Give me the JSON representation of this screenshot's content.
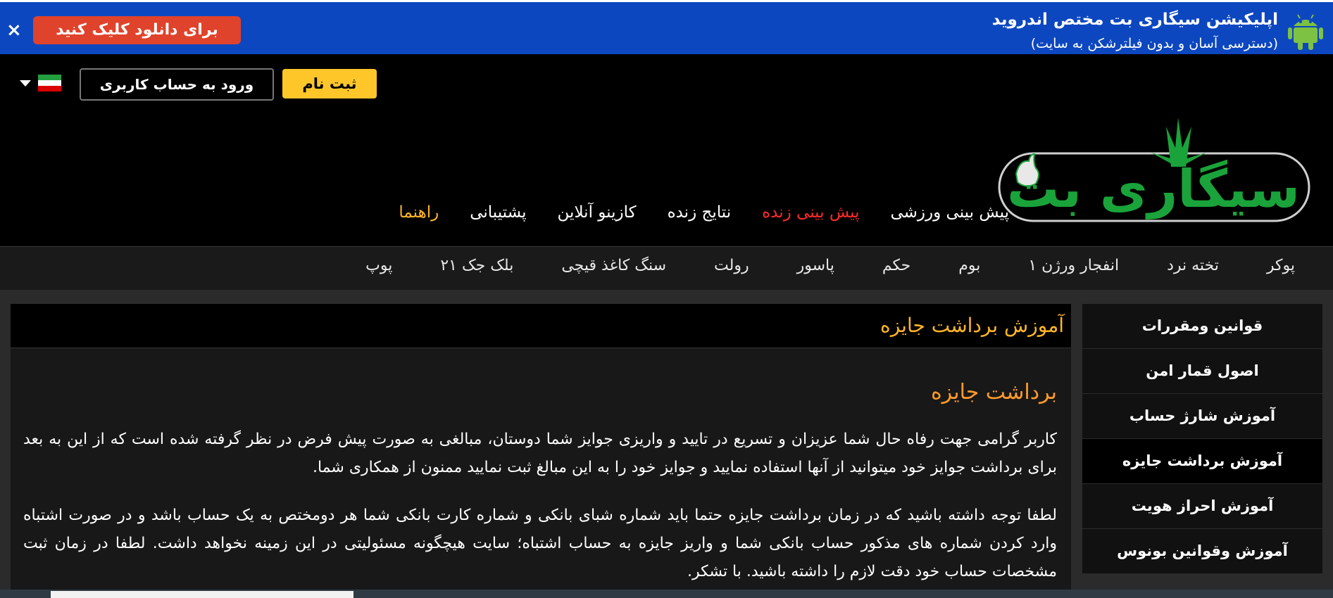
{
  "banner": {
    "title": "اپلیکیشن سیگاری بت مختص اندروید",
    "subtitle": "(دسترسی آسان و بدون فیلترشکن به سایت)",
    "download_label": "برای دانلود کلیک کنید",
    "close_label": "×",
    "icon": "android-icon",
    "color": "#0d47c0"
  },
  "header": {
    "register_label": "ثبت نام",
    "login_label": "ورود به حساب کاربری",
    "language_flag": "iran-flag-icon",
    "logo_text": "سیگاری بت",
    "accent": "#ffc62a"
  },
  "nav": {
    "items": [
      {
        "label": "پیش بینی ورزشی"
      },
      {
        "label": "پیش بینی زنده"
      },
      {
        "label": "نتایج زنده"
      },
      {
        "label": "کازینو آنلاین"
      },
      {
        "label": "پشتیبانی"
      },
      {
        "label": "راهنما"
      }
    ]
  },
  "games": {
    "items": [
      {
        "label": "پوکر"
      },
      {
        "label": "تخته نرد"
      },
      {
        "label": "انفجار ورژن ۱"
      },
      {
        "label": "بوم"
      },
      {
        "label": "حکم"
      },
      {
        "label": "پاسور"
      },
      {
        "label": "رولت"
      },
      {
        "label": "سنگ کاغذ قیچی"
      },
      {
        "label": "بلک جک ۲۱"
      },
      {
        "label": "پوپ"
      }
    ]
  },
  "sidebar": {
    "items": [
      {
        "label": "قوانین ومقررات"
      },
      {
        "label": "اصول قمار امن"
      },
      {
        "label": "آموزش شارژ حساب"
      },
      {
        "label": "آموزش برداشت جایزه"
      },
      {
        "label": "آموزش احراز هویت"
      },
      {
        "label": "آموزش وقوانین بونوس"
      }
    ]
  },
  "content": {
    "header": "آموزش برداشت جایزه",
    "title": "برداشت جایزه",
    "paragraph1": "کاربر گرامی جهت رفاه حال شما عزیزان و تسریع در تایید و واریزی جوایز شما دوستان، مبالغی به صورت پیش فرض در نظر گرفته شده است که از این به بعد برای برداشت جوایز خود میتوانید از آنها استفاده نمایید و جوایز خود را به این مبالغ ثبت نمایید ممنون از همکاری شما.",
    "paragraph2": "لطفا توجه داشته باشید که در زمان برداشت جایزه حتما باید شماره شبای بانکی و شماره کارت بانکی شما هر دومختص به یک حساب باشد و در صورت اشتباه وارد کردن شماره های مذکور حساب بانکی شما و واریز جایزه به حساب اشتباه؛ سایت هیچگونه مسئولیتی در این زمینه نخواهد داشت. لطفا در زمان ثبت مشخصات حساب خود دقت لازم را داشته باشید. با تشکر."
  }
}
